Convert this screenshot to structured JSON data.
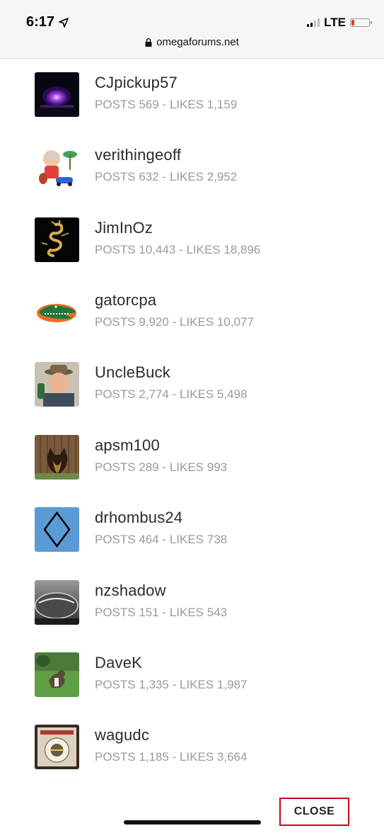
{
  "status_bar": {
    "time": "6:17",
    "network": "LTE",
    "url": "omegaforums.net",
    "icons": [
      "location-arrow-icon",
      "signal-icon",
      "battery-low-icon",
      "lock-icon"
    ],
    "battery_color": "#e53935"
  },
  "members": [
    {
      "username": "CJpickup57",
      "stats": "POSTS 569 - LIKES 1,159",
      "avatar": "purple-dome-avatar"
    },
    {
      "username": "verithingeoff",
      "stats": "POSTS 632 - LIKES 2,952",
      "avatar": "cartoon-caricature-avatar"
    },
    {
      "username": "JimInOz",
      "stats": "POSTS 10,443 - LIKES 18,896",
      "avatar": "gold-dragon-avatar"
    },
    {
      "username": "gatorcpa",
      "stats": "POSTS 9,920 - LIKES 10,077",
      "avatar": "gator-logo-avatar"
    },
    {
      "username": "UncleBuck",
      "stats": "POSTS 2,774 - LIKES 5,498",
      "avatar": "man-with-hat-avatar"
    },
    {
      "username": "apsm100",
      "stats": "POSTS 289 - LIKES 993",
      "avatar": "dog-fence-avatar"
    },
    {
      "username": "drhombus24",
      "stats": "POSTS 464 - LIKES 738",
      "avatar": "rhombus-avatar"
    },
    {
      "username": "nzshadow",
      "stats": "POSTS 151 - LIKES 543",
      "avatar": "watch-crystal-avatar"
    },
    {
      "username": "DaveK",
      "stats": "POSTS 1,335 - LIKES 1,987",
      "avatar": "dog-grass-avatar"
    },
    {
      "username": "wagudc",
      "stats": "POSTS 1,185 - LIKES 3,664",
      "avatar": "vintage-plate-avatar"
    }
  ],
  "close_label": "CLOSE",
  "colors": {
    "close_border": "#d0021b",
    "stats_text": "#9a9a9a",
    "rhombus_bg": "#5b9bd5"
  }
}
